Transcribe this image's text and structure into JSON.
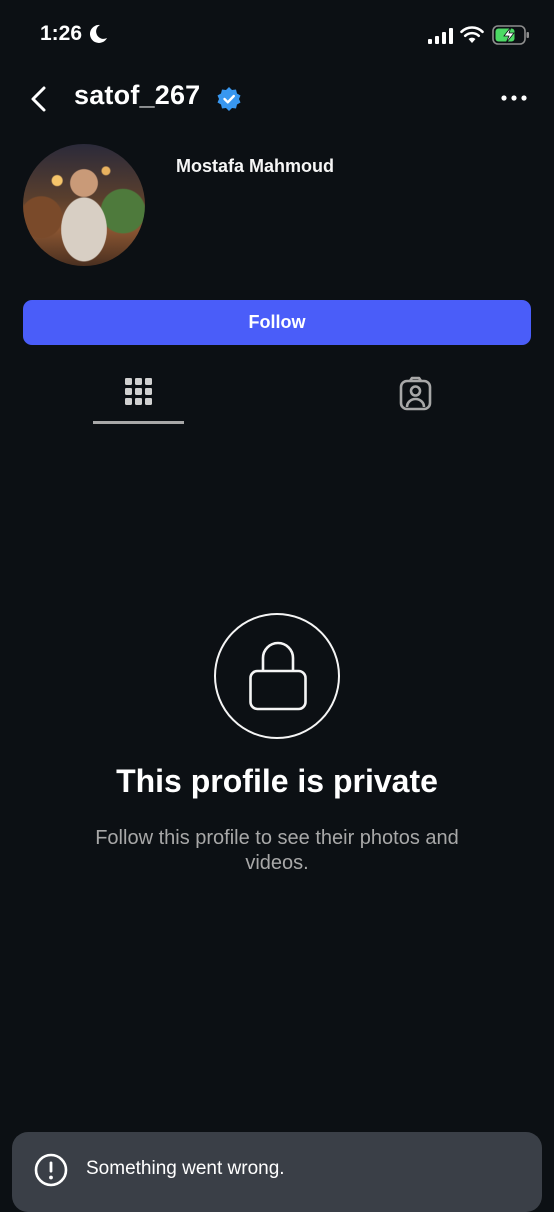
{
  "status_bar": {
    "time": "1:26",
    "icons": [
      "moon-icon",
      "signal-icon",
      "wifi-icon",
      "battery-charging-icon"
    ]
  },
  "header": {
    "username": "satof_267",
    "verified_icon": "verified-badge-icon",
    "back_icon": "back-arrow-icon",
    "more_icon": "more-options-icon"
  },
  "profile": {
    "display_name": "Mostafa Mahmoud",
    "follow_label": "Follow"
  },
  "tabs": [
    {
      "name": "posts-grid",
      "icon": "grid-icon",
      "active": true
    },
    {
      "name": "tagged",
      "icon": "tagged-person-icon",
      "active": false
    }
  ],
  "private_notice": {
    "icon": "lock-icon",
    "title": "This profile is private",
    "description": "Follow this profile to see their photos and videos."
  },
  "toast": {
    "icon": "alert-circle-icon",
    "message": "Something went wrong."
  },
  "colors": {
    "background": "#0c1014",
    "follow_button": "#4a5df9",
    "verified": "#3897f0",
    "toast_bg": "#3a3f47",
    "secondary_text": "#a8a8a8",
    "battery_green": "#4cd964"
  }
}
